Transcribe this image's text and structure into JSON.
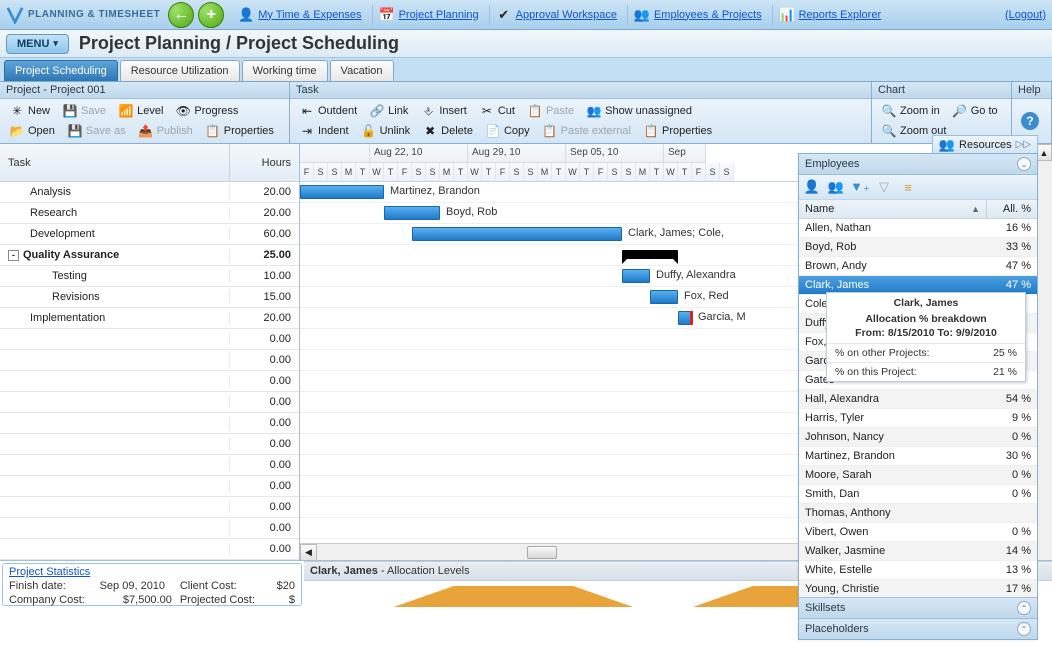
{
  "app": {
    "name": "PLANNING & TIMESHEET"
  },
  "topnav": {
    "back_icon": "←",
    "add_icon": "+",
    "links": [
      {
        "label": "My Time & Expenses",
        "icon": "👤"
      },
      {
        "label": "Project Planning",
        "icon": "📅"
      },
      {
        "label": "Approval Workspace",
        "icon": "✔"
      },
      {
        "label": "Employees & Projects",
        "icon": "👥"
      },
      {
        "label": "Reports Explorer",
        "icon": "📊"
      }
    ],
    "logout": "(Logout)"
  },
  "header": {
    "menu": "MENU",
    "title": "Project Planning / Project Scheduling"
  },
  "subtabs": [
    "Project Scheduling",
    "Resource Utilization",
    "Working time",
    "Vacation"
  ],
  "sections": {
    "project": {
      "title": "Project - Project 001",
      "row1": [
        {
          "id": "new",
          "label": "New",
          "icon": "✳"
        },
        {
          "id": "save",
          "label": "Save",
          "icon": "💾",
          "disabled": true
        },
        {
          "id": "level",
          "label": "Level",
          "icon": "📶"
        },
        {
          "id": "progress",
          "label": "Progress",
          "icon": "👁"
        }
      ],
      "row2": [
        {
          "id": "open",
          "label": "Open",
          "icon": "📂"
        },
        {
          "id": "saveas",
          "label": "Save as",
          "icon": "💾",
          "disabled": true
        },
        {
          "id": "publish",
          "label": "Publish",
          "icon": "📤",
          "disabled": true
        },
        {
          "id": "properties",
          "label": "Properties",
          "icon": "📋"
        }
      ]
    },
    "task": {
      "title": "Task",
      "row1": [
        {
          "id": "outdent",
          "label": "Outdent",
          "icon": "⇤"
        },
        {
          "id": "link",
          "label": "Link",
          "icon": "🔗"
        },
        {
          "id": "insert",
          "label": "Insert",
          "icon": "⎀"
        },
        {
          "id": "cut",
          "label": "Cut",
          "icon": "✂"
        },
        {
          "id": "paste",
          "label": "Paste",
          "icon": "📋",
          "disabled": true
        },
        {
          "id": "showun",
          "label": "Show unassigned",
          "icon": "👥"
        }
      ],
      "row2": [
        {
          "id": "indent",
          "label": "Indent",
          "icon": "⇥"
        },
        {
          "id": "unlink",
          "label": "Unlink",
          "icon": "🔓"
        },
        {
          "id": "delete",
          "label": "Delete",
          "icon": "✖"
        },
        {
          "id": "copy",
          "label": "Copy",
          "icon": "📄"
        },
        {
          "id": "pasteext",
          "label": "Paste external",
          "icon": "📋",
          "disabled": true
        },
        {
          "id": "tprops",
          "label": "Properties",
          "icon": "📋"
        }
      ]
    },
    "chart": {
      "title": "Chart",
      "row1": [
        {
          "id": "zoomin",
          "label": "Zoom in",
          "icon": "🔍"
        },
        {
          "id": "goto",
          "label": "Go to",
          "icon": "🔎"
        }
      ],
      "row2": [
        {
          "id": "zoomout",
          "label": "Zoom out",
          "icon": "🔍"
        }
      ]
    },
    "help": {
      "title": "Help"
    }
  },
  "taskgrid": {
    "col_task": "Task",
    "col_hours": "Hours",
    "rows": [
      {
        "name": "Analysis",
        "hours": "20.00",
        "indent": 1
      },
      {
        "name": "Research",
        "hours": "20.00",
        "indent": 1
      },
      {
        "name": "Development",
        "hours": "60.00",
        "indent": 1
      },
      {
        "name": "Quality Assurance",
        "hours": "25.00",
        "indent": 0,
        "bold": true,
        "expander": "-"
      },
      {
        "name": "Testing",
        "hours": "10.00",
        "indent": 2
      },
      {
        "name": "Revisions",
        "hours": "15.00",
        "indent": 2
      },
      {
        "name": "Implementation",
        "hours": "20.00",
        "indent": 1
      },
      {
        "name": "",
        "hours": "0.00"
      },
      {
        "name": "",
        "hours": "0.00"
      },
      {
        "name": "",
        "hours": "0.00"
      },
      {
        "name": "",
        "hours": "0.00"
      },
      {
        "name": "",
        "hours": "0.00"
      },
      {
        "name": "",
        "hours": "0.00"
      },
      {
        "name": "",
        "hours": "0.00"
      },
      {
        "name": "",
        "hours": "0.00"
      },
      {
        "name": "",
        "hours": "0.00"
      },
      {
        "name": "",
        "hours": "0.00"
      },
      {
        "name": "",
        "hours": "0.00"
      }
    ]
  },
  "gantt": {
    "weeks": [
      "Aug 22, 10",
      "Aug 29, 10",
      "Sep 05, 10",
      "Sep"
    ],
    "days": [
      "F",
      "S",
      "S",
      "M",
      "T",
      "W",
      "T",
      "F",
      "S",
      "S",
      "M",
      "T",
      "W",
      "T",
      "F",
      "S",
      "S",
      "M",
      "T",
      "W",
      "T",
      "F",
      "S",
      "S",
      "M",
      "T",
      "W",
      "T",
      "F",
      "S",
      "S"
    ],
    "first_week_start_day": 2,
    "bars": [
      {
        "row": 0,
        "start": 0,
        "len": 6,
        "label": "Martinez, Brandon"
      },
      {
        "row": 1,
        "start": 6,
        "len": 4,
        "label": "Boyd, Rob"
      },
      {
        "row": 2,
        "start": 8,
        "len": 15,
        "label": "Clark, James; Cole,"
      },
      {
        "row": 3,
        "start": 23,
        "len": 4,
        "label": "",
        "summary": true
      },
      {
        "row": 4,
        "start": 23,
        "len": 2,
        "label": "Duffy, Alexandra"
      },
      {
        "row": 5,
        "start": 25,
        "len": 2,
        "label": "Fox, Red"
      },
      {
        "row": 6,
        "start": 27,
        "len": 1,
        "label": "Garcia, M",
        "milestone": true
      }
    ]
  },
  "stats": {
    "link": "Project Statistics",
    "finish_label": "Finish date:",
    "finish_val": "Sep 09, 2010",
    "client_label": "Client Cost:",
    "client_val": "$20",
    "company_label": "Company Cost:",
    "company_val": "$7,500.00",
    "projected_label": "Projected Cost:",
    "projected_val": "$"
  },
  "alloc": {
    "name": "Clark, James",
    "suffix": " - Allocation Levels"
  },
  "resources_btn": "Resources",
  "employees": {
    "header": "Employees",
    "col_name": "Name",
    "col_all": "All. %",
    "rows": [
      {
        "name": "Allen, Nathan",
        "pct": "16 %"
      },
      {
        "name": "Boyd, Rob",
        "pct": "33 %"
      },
      {
        "name": "Brown, Andy",
        "pct": "47 %"
      },
      {
        "name": "Clark, James",
        "pct": "47 %",
        "selected": true
      },
      {
        "name": "Cole,",
        "pct": ""
      },
      {
        "name": "Duffy",
        "pct": ""
      },
      {
        "name": "Fox, R",
        "pct": ""
      },
      {
        "name": "Garcia",
        "pct": ""
      },
      {
        "name": "Gates",
        "pct": ""
      },
      {
        "name": "Hall, Alexandra",
        "pct": "54 %"
      },
      {
        "name": "Harris, Tyler",
        "pct": "9 %"
      },
      {
        "name": "Johnson, Nancy",
        "pct": "0 %"
      },
      {
        "name": "Martinez, Brandon",
        "pct": "30 %"
      },
      {
        "name": "Moore, Sarah",
        "pct": "0 %"
      },
      {
        "name": "Smith, Dan",
        "pct": "0 %"
      },
      {
        "name": "Thomas, Anthony",
        "pct": ""
      },
      {
        "name": "Vibert, Owen",
        "pct": "0 %"
      },
      {
        "name": "Walker, Jasmine",
        "pct": "14 %"
      },
      {
        "name": "White, Estelle",
        "pct": "13 %"
      },
      {
        "name": "Young, Christie",
        "pct": "17 %"
      }
    ],
    "footer1": "Skillsets",
    "footer2": "Placeholders"
  },
  "tooltip": {
    "name": "Clark, James",
    "sub": "Allocation % breakdown",
    "range": "From: 8/15/2010 To: 9/9/2010",
    "other_label": "% on other Projects:",
    "other_val": "25 %",
    "this_label": "% on this Project:",
    "this_val": "21 %"
  }
}
